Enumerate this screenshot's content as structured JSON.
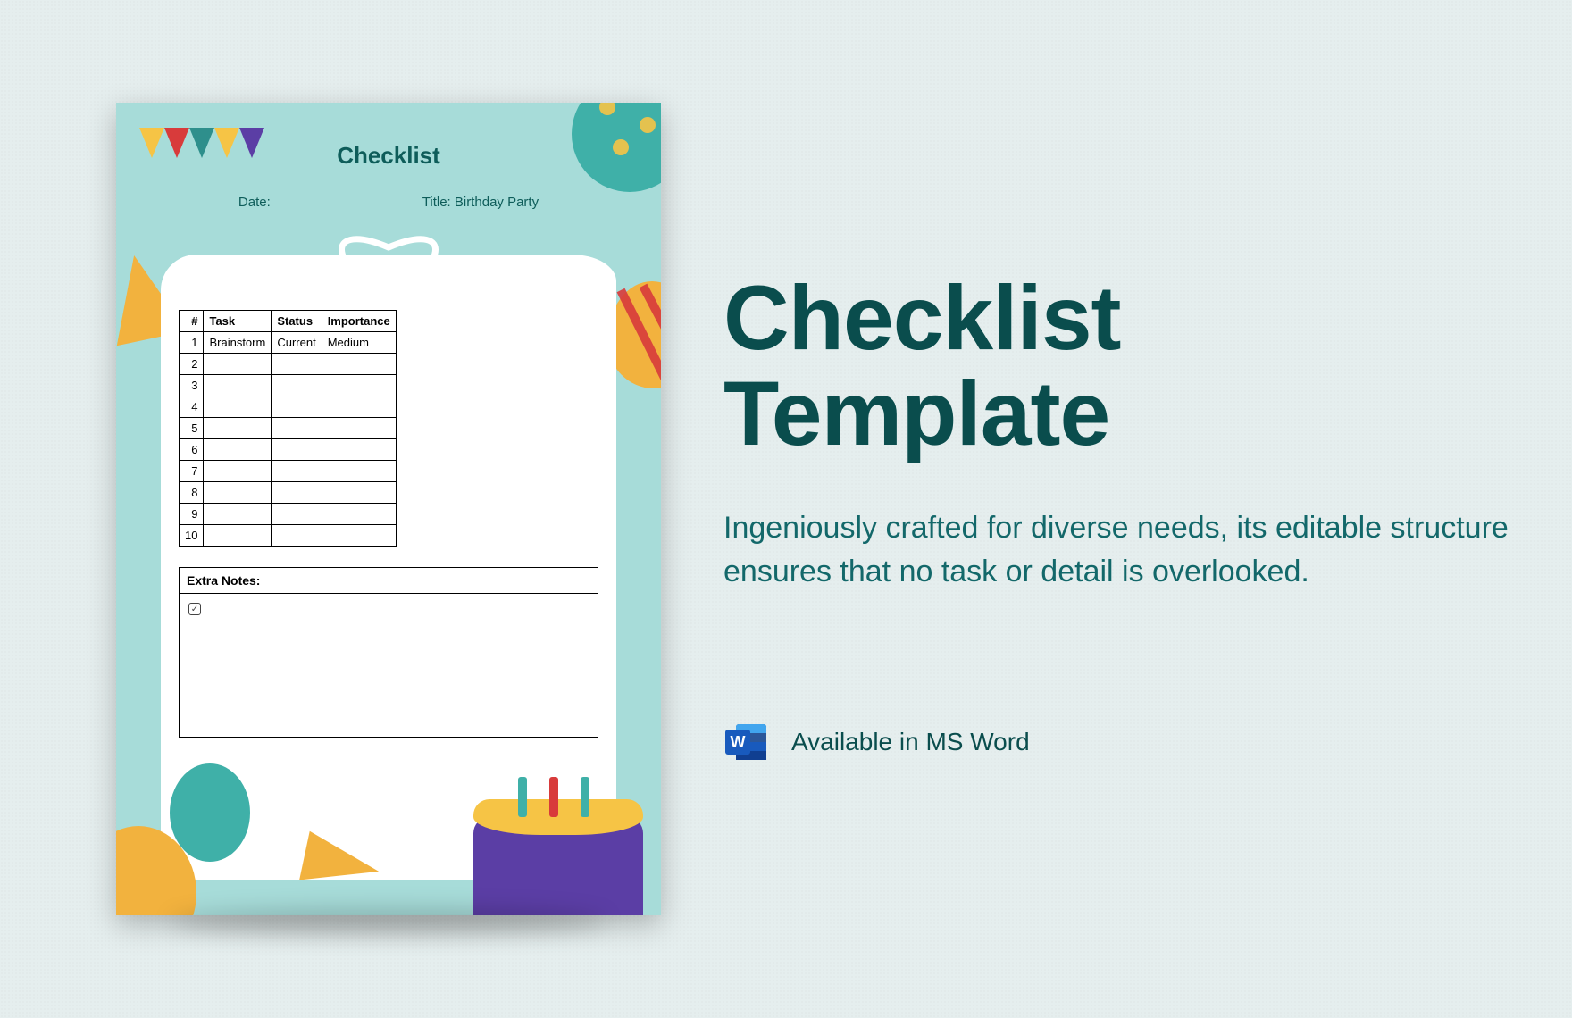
{
  "page": {
    "heading": "Checklist Template",
    "description": "Ingeniously crafted for diverse needs, its editable structure ensures that no task or detail is overlooked.",
    "available_label": "Available in MS Word"
  },
  "doc": {
    "title": "Checklist",
    "date_label": "Date:",
    "title_label": "Title: Birthday Party",
    "columns": {
      "num": "#",
      "task": "Task",
      "status": "Status",
      "importance": "Importance"
    },
    "rows": [
      {
        "n": "1",
        "task": "Brainstorm",
        "status": "Current",
        "importance": "Medium"
      },
      {
        "n": "2",
        "task": "",
        "status": "",
        "importance": ""
      },
      {
        "n": "3",
        "task": "",
        "status": "",
        "importance": ""
      },
      {
        "n": "4",
        "task": "",
        "status": "",
        "importance": ""
      },
      {
        "n": "5",
        "task": "",
        "status": "",
        "importance": ""
      },
      {
        "n": "6",
        "task": "",
        "status": "",
        "importance": ""
      },
      {
        "n": "7",
        "task": "",
        "status": "",
        "importance": ""
      },
      {
        "n": "8",
        "task": "",
        "status": "",
        "importance": ""
      },
      {
        "n": "9",
        "task": "",
        "status": "",
        "importance": ""
      },
      {
        "n": "10",
        "task": "",
        "status": "",
        "importance": ""
      }
    ],
    "notes_label": "Extra Notes:",
    "notes_checkbox": "✓"
  }
}
